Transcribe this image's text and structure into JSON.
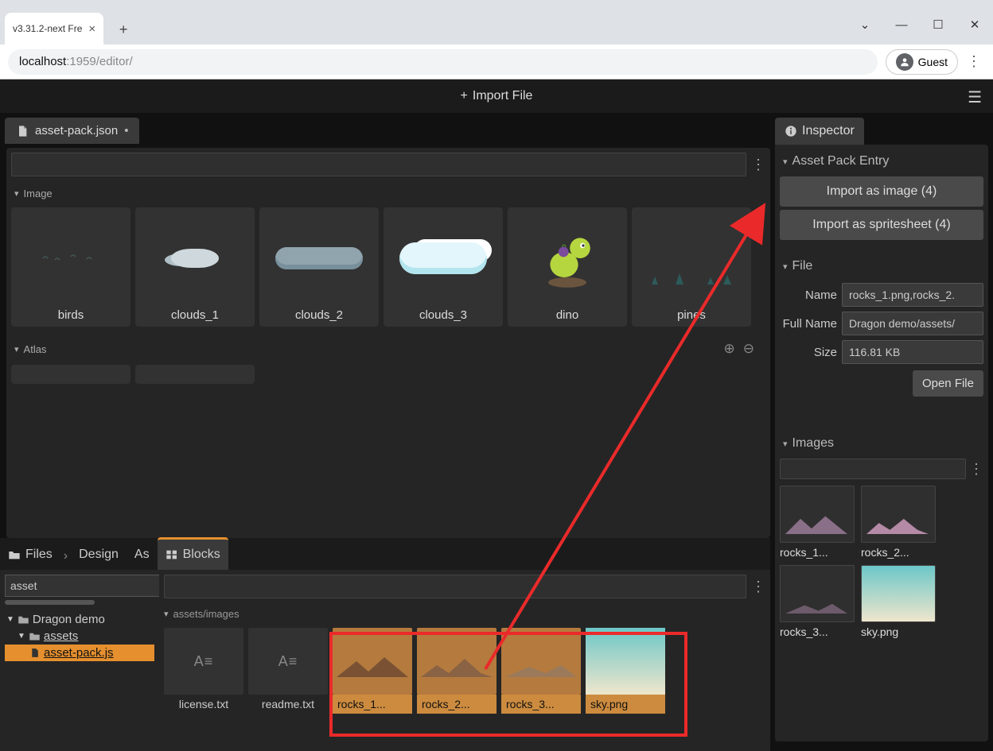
{
  "browser": {
    "tab_title": "v3.31.2-next Fre",
    "url_host": "localhost",
    "url_port": ":1959",
    "url_path": "/editor/",
    "guest": "Guest"
  },
  "app": {
    "import_file": "Import File",
    "editor_tab": "asset-pack.json",
    "dirty_marker": "•",
    "section_image": "Image",
    "section_atlas": "Atlas",
    "thumbs": {
      "birds": "birds",
      "clouds_1": "clouds_1",
      "clouds_2": "clouds_2",
      "clouds_3": "clouds_3",
      "dino": "dino",
      "pines": "pines"
    }
  },
  "bottom": {
    "tab_files": "Files",
    "tab_design": "Design",
    "tab_assets_short": "As",
    "tab_blocks": "Blocks",
    "tree_filter": "asset",
    "tree": {
      "root": "Dragon demo",
      "assets": "assets",
      "pack": "asset-pack.js"
    },
    "section": "assets/images",
    "items": {
      "license": "license.txt",
      "readme": "readme.txt",
      "r1": "rocks_1...",
      "r2": "rocks_2...",
      "r3": "rocks_3...",
      "sky": "sky.png"
    }
  },
  "inspector": {
    "title": "Inspector",
    "entry_hdr": "Asset Pack Entry",
    "import_image": "Import as image (4)",
    "import_spritesheet": "Import as spritesheet (4)",
    "file_hdr": "File",
    "name_lbl": "Name",
    "name_val": "rocks_1.png,rocks_2.",
    "fullname_lbl": "Full Name",
    "fullname_val": "Dragon demo/assets/",
    "size_lbl": "Size",
    "size_val": "116.81 KB",
    "open_file": "Open File",
    "images_hdr": "Images",
    "imgs": {
      "r1": "rocks_1...",
      "r2": "rocks_2...",
      "r3": "rocks_3...",
      "sky": "sky.png"
    }
  }
}
